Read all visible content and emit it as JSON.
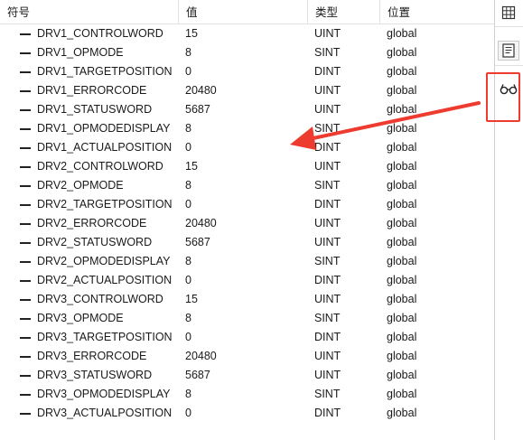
{
  "table": {
    "headers": {
      "symbol": "符号",
      "value": "值",
      "type": "类型",
      "scope": "位置"
    },
    "rows": [
      {
        "name": "DRV1_CONTROLWORD",
        "value": "15",
        "type": "UINT",
        "scope": "global"
      },
      {
        "name": "DRV1_OPMODE",
        "value": "8",
        "type": "SINT",
        "scope": "global"
      },
      {
        "name": "DRV1_TARGETPOSITION",
        "value": "0",
        "type": "DINT",
        "scope": "global"
      },
      {
        "name": "DRV1_ERRORCODE",
        "value": "20480",
        "type": "UINT",
        "scope": "global"
      },
      {
        "name": "DRV1_STATUSWORD",
        "value": "5687",
        "type": "UINT",
        "scope": "global"
      },
      {
        "name": "DRV1_OPMODEDISPLAY",
        "value": "8",
        "type": "SINT",
        "scope": "global"
      },
      {
        "name": "DRV1_ACTUALPOSITION",
        "value": "0",
        "type": "DINT",
        "scope": "global"
      },
      {
        "name": "DRV2_CONTROLWORD",
        "value": "15",
        "type": "UINT",
        "scope": "global"
      },
      {
        "name": "DRV2_OPMODE",
        "value": "8",
        "type": "SINT",
        "scope": "global"
      },
      {
        "name": "DRV2_TARGETPOSITION",
        "value": "0",
        "type": "DINT",
        "scope": "global"
      },
      {
        "name": "DRV2_ERRORCODE",
        "value": "20480",
        "type": "UINT",
        "scope": "global"
      },
      {
        "name": "DRV2_STATUSWORD",
        "value": "5687",
        "type": "UINT",
        "scope": "global"
      },
      {
        "name": "DRV2_OPMODEDISPLAY",
        "value": "8",
        "type": "SINT",
        "scope": "global"
      },
      {
        "name": "DRV2_ACTUALPOSITION",
        "value": "0",
        "type": "DINT",
        "scope": "global"
      },
      {
        "name": "DRV3_CONTROLWORD",
        "value": "15",
        "type": "UINT",
        "scope": "global"
      },
      {
        "name": "DRV3_OPMODE",
        "value": "8",
        "type": "SINT",
        "scope": "global"
      },
      {
        "name": "DRV3_TARGETPOSITION",
        "value": "0",
        "type": "DINT",
        "scope": "global"
      },
      {
        "name": "DRV3_ERRORCODE",
        "value": "20480",
        "type": "UINT",
        "scope": "global"
      },
      {
        "name": "DRV3_STATUSWORD",
        "value": "5687",
        "type": "UINT",
        "scope": "global"
      },
      {
        "name": "DRV3_OPMODEDISPLAY",
        "value": "8",
        "type": "SINT",
        "scope": "global"
      },
      {
        "name": "DRV3_ACTUALPOSITION",
        "value": "0",
        "type": "DINT",
        "scope": "global"
      }
    ]
  },
  "toolbar": {
    "buttons": [
      {
        "icon": "grid-view-icon"
      },
      {
        "icon": "form-view-icon"
      },
      {
        "icon": "watch-glasses-icon"
      }
    ]
  },
  "annotation": {
    "color": "#ee3b30"
  }
}
